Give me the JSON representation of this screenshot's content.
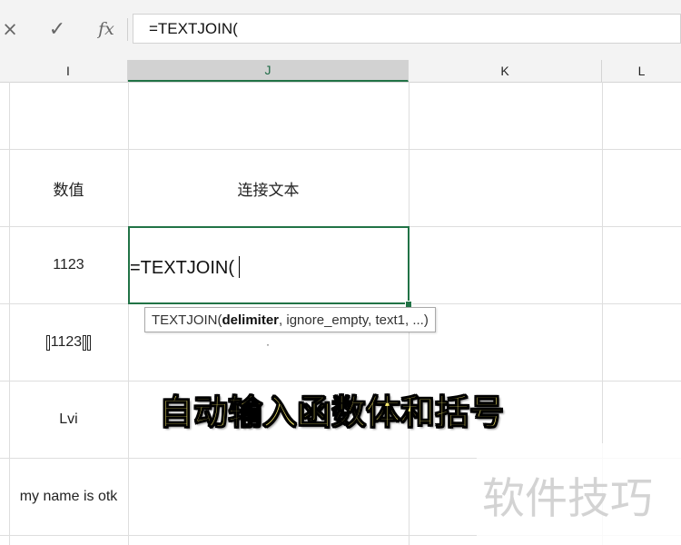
{
  "formula_bar": {
    "cancel_icon": "×",
    "enter_icon": "✓",
    "function_icon": "fx",
    "formula": "=TEXTJOIN("
  },
  "columns": [
    {
      "label": "I"
    },
    {
      "label": "J"
    },
    {
      "label": "K"
    },
    {
      "label": "L"
    }
  ],
  "cells": {
    "I_row_header": "数值",
    "J_row_header": "连接文本",
    "I_1123": "1123",
    "I_1123_special": "1123",
    "I_lvi": "Lvi",
    "I_sentence": "my name is otk"
  },
  "editing": {
    "active_cell_text": "=TEXTJOIN(",
    "tooltip": {
      "function_name": "TEXTJOIN(",
      "bold_parameter": "delimiter",
      "remaining_parameters": ", ignore_empty, text1, ...)"
    }
  },
  "annotation": {
    "caption": "自动输入函数体和括号",
    "watermark": "软件技巧"
  },
  "colors": {
    "excel_green": "#217346",
    "caption_fill": "#f7e96b"
  }
}
